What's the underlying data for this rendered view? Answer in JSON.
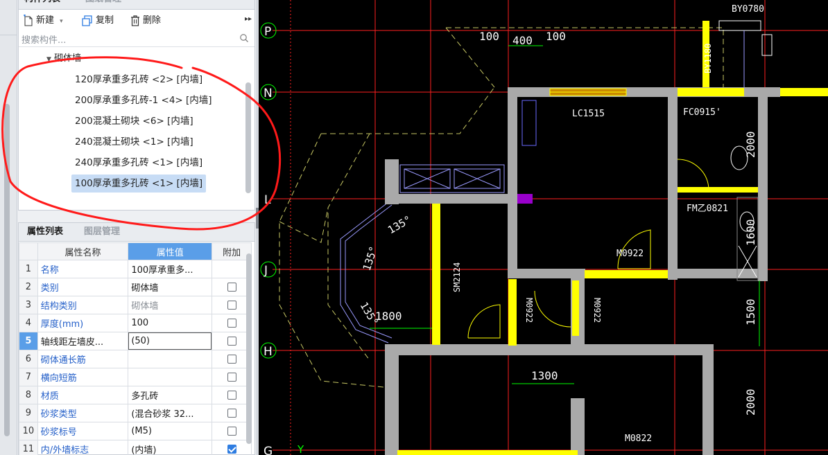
{
  "component_panel": {
    "tabs": [
      "构件列表",
      "图纸管理"
    ],
    "toolbar": {
      "new": "新建",
      "copy": "复制",
      "delete": "删除",
      "more": "▸▸"
    },
    "search_placeholder": "搜索构件...",
    "tree_root": "砌体墙",
    "items": [
      "120厚承重多孔砖 <2> [内墙]",
      "200厚承重多孔砖-1 <4> [内墙]",
      "200混凝土砌块 <6> [内墙]",
      "240混凝土砌块 <1> [内墙]",
      "240厚承重多孔砖 <1> [内墙]",
      "100厚承重多孔砖 <1> [内墙]"
    ],
    "selected_index": 5
  },
  "property_panel": {
    "tabs": [
      "属性列表",
      "图层管理"
    ],
    "headers": [
      "属性名称",
      "属性值",
      "附加"
    ],
    "rows": [
      {
        "num": "1",
        "name": "名称",
        "value": "100厚承重多...",
        "blue": true,
        "check": null
      },
      {
        "num": "2",
        "name": "类别",
        "value": "砌体墙",
        "blue": true,
        "check": false
      },
      {
        "num": "3",
        "name": "结构类别",
        "value": "砌体墙",
        "blue": true,
        "check": false,
        "gray": true
      },
      {
        "num": "4",
        "name": "厚度(mm)",
        "value": "100",
        "blue": true,
        "check": false
      },
      {
        "num": "5",
        "name": "轴线距左墙皮...",
        "value": "(50)",
        "blue": false,
        "check": false,
        "selected": true
      },
      {
        "num": "6",
        "name": "砌体通长筋",
        "value": "",
        "blue": true,
        "check": false
      },
      {
        "num": "7",
        "name": "横向短筋",
        "value": "",
        "blue": true,
        "check": false
      },
      {
        "num": "8",
        "name": "材质",
        "value": "多孔砖",
        "blue": true,
        "check": false
      },
      {
        "num": "9",
        "name": "砂浆类型",
        "value": "(混合砂浆 32...",
        "blue": true,
        "check": false
      },
      {
        "num": "10",
        "name": "砂浆标号",
        "value": "(M5)",
        "blue": true,
        "check": false
      },
      {
        "num": "11",
        "name": "内/外墙标志",
        "value": "(内墙)",
        "blue": true,
        "check": true
      }
    ]
  },
  "drawing": {
    "axes_rows": [
      "P",
      "N",
      "L",
      "J",
      "H",
      "G"
    ],
    "y_axis": "Y",
    "dims": [
      "100",
      "400",
      "100",
      "1800",
      "1300",
      "1500",
      "2000",
      "2000",
      "1600"
    ],
    "angles": [
      "135°",
      "135°",
      "135°"
    ],
    "labels": [
      "LC1515",
      "FC0915'",
      "FM乙0821",
      "M0922",
      "SM2124",
      "M0922",
      "M0922",
      "M0822",
      "BY0780",
      "BY1180"
    ],
    "colors": {
      "wall": "#a9a9a9",
      "yellow": "#ffff00",
      "axis_red": "#ff2020",
      "dash": "#c8c864",
      "magenta": "#9900cc",
      "green": "#00ff00"
    }
  }
}
